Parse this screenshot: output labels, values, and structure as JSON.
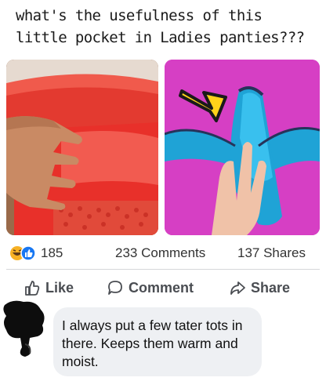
{
  "post": {
    "caption": "what's the usefulness of this little pocket in Ladies panties???"
  },
  "reactions": {
    "count": "185",
    "icons": [
      "haha-emoji-icon",
      "like-thumb-icon"
    ],
    "comments": "233 Comments",
    "shares": "137 Shares"
  },
  "actions": {
    "like_label": "Like",
    "comment_label": "Comment",
    "share_label": "Share"
  },
  "comment": {
    "text": "I always put a few tater tots in there. Keeps them warm and moist."
  },
  "colors": {
    "facebook_blue": "#1877f2",
    "haha_yellow": "#f7b125",
    "panties_red": "#e8302a",
    "panties_blue": "#1fa3d6",
    "magenta_background": "#d63fc4",
    "arrow_yellow": "#ffd21a",
    "comment_bubble": "#eef0f3"
  }
}
